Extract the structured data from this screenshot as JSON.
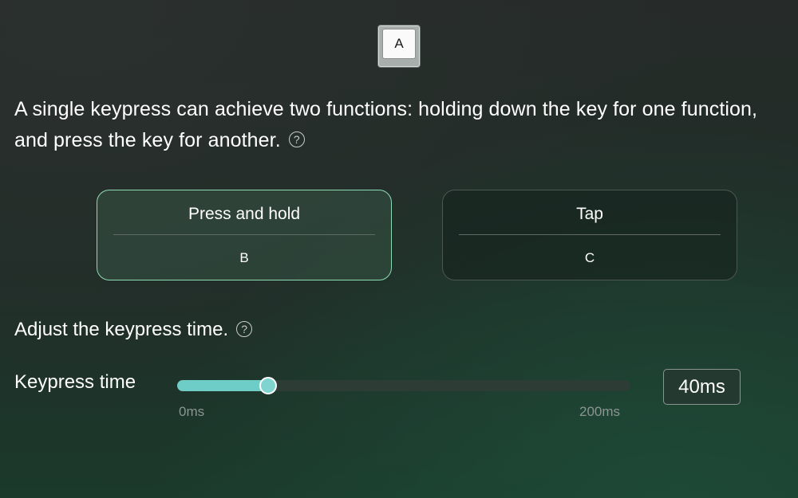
{
  "key": {
    "label": "A"
  },
  "description": {
    "text": "A single keypress can achieve two functions: holding down the key for one function, and press the key for another.",
    "help_glyph": "?"
  },
  "modes": [
    {
      "title": "Press and hold",
      "value": "B",
      "active": true
    },
    {
      "title": "Tap",
      "value": "C",
      "active": false
    }
  ],
  "adjust": {
    "title": "Adjust the keypress time.",
    "help_glyph": "?"
  },
  "slider": {
    "label": "Keypress time",
    "value": 40,
    "min": 0,
    "max": 200,
    "min_label": "0ms",
    "max_label": "200ms",
    "value_display": "40ms"
  },
  "colors": {
    "accent": "#6fcdc8",
    "active_border": "#8ddcb4"
  },
  "icons": {
    "help": "question-circle-icon"
  }
}
